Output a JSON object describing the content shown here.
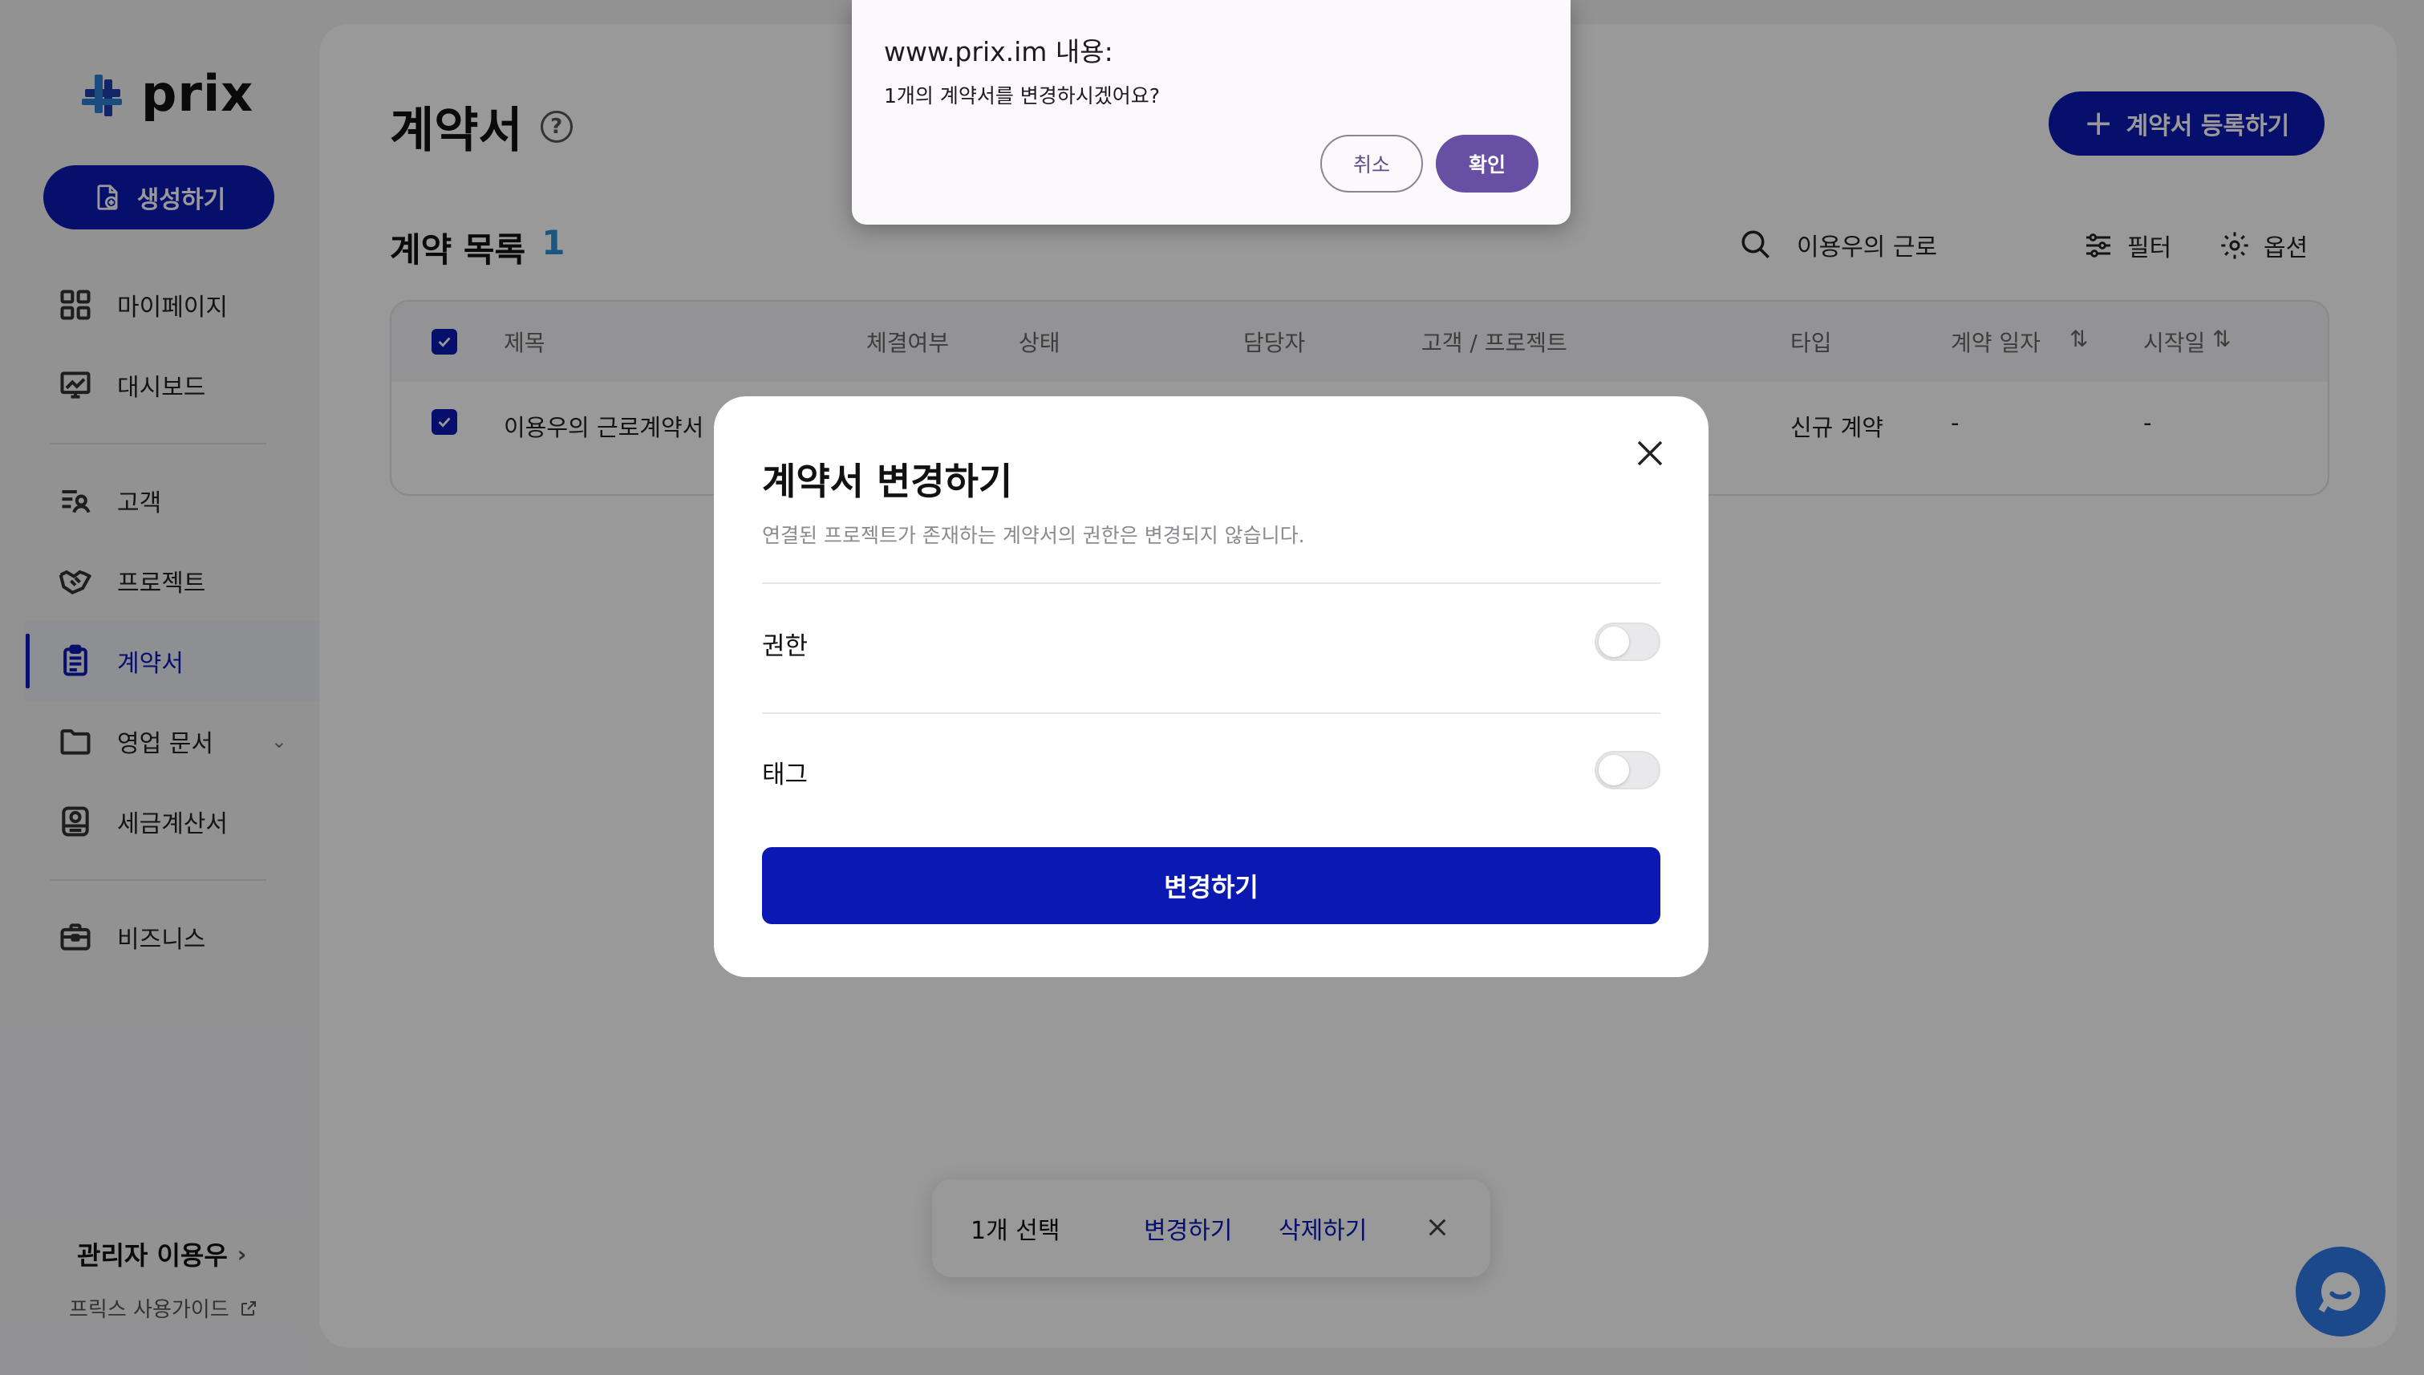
{
  "brand": {
    "name": "prix",
    "accent": "#0b19b3"
  },
  "sidebar": {
    "create_label": "생성하기",
    "items": [
      {
        "label": "마이페이지",
        "icon": "grid-icon"
      },
      {
        "label": "대시보드",
        "icon": "presentation-chart-icon"
      },
      {
        "label": "고객",
        "icon": "users-list-icon"
      },
      {
        "label": "프로젝트",
        "icon": "handshake-icon"
      },
      {
        "label": "계약서",
        "icon": "clipboard-icon",
        "active": true
      },
      {
        "label": "영업 문서",
        "icon": "folder-icon"
      },
      {
        "label": "세금계산서",
        "icon": "receipt-icon"
      },
      {
        "label": "비즈니스",
        "icon": "briefcase-icon"
      }
    ],
    "admin_label": "관리자 이용우",
    "guide_label": "프릭스 사용가이드"
  },
  "header": {
    "title": "계약서",
    "help": "?",
    "register_label": "계약서 등록하기"
  },
  "list": {
    "title": "계약 목록",
    "count": "1",
    "search_value": "이용우의 근로",
    "filter_label": "필터",
    "options_label": "옵션"
  },
  "table": {
    "columns": [
      "제목",
      "체결여부",
      "상태",
      "담당자",
      "고객 / 프로젝트",
      "타입",
      "계약 일자",
      "시작일"
    ],
    "rows": [
      {
        "title": "이용우의 근로계약서",
        "type": "신규 계약",
        "contract_date": "-",
        "start_date": "-"
      }
    ]
  },
  "bulk_bar": {
    "selected": "1개 선택",
    "change": "변경하기",
    "delete": "삭제하기"
  },
  "modal": {
    "title": "계약서 변경하기",
    "subtitle": "연결된 프로젝트가 존재하는 계약서의 권한은 변경되지 않습니다.",
    "field_permission": "권한",
    "field_tag": "태그",
    "permission_on": false,
    "tag_on": false,
    "submit_label": "변경하기"
  },
  "confirm_dialog": {
    "title": "www.prix.im 내용:",
    "message": "1개의 계약서를 변경하시겠어요?",
    "cancel": "취소",
    "ok": "확인"
  }
}
